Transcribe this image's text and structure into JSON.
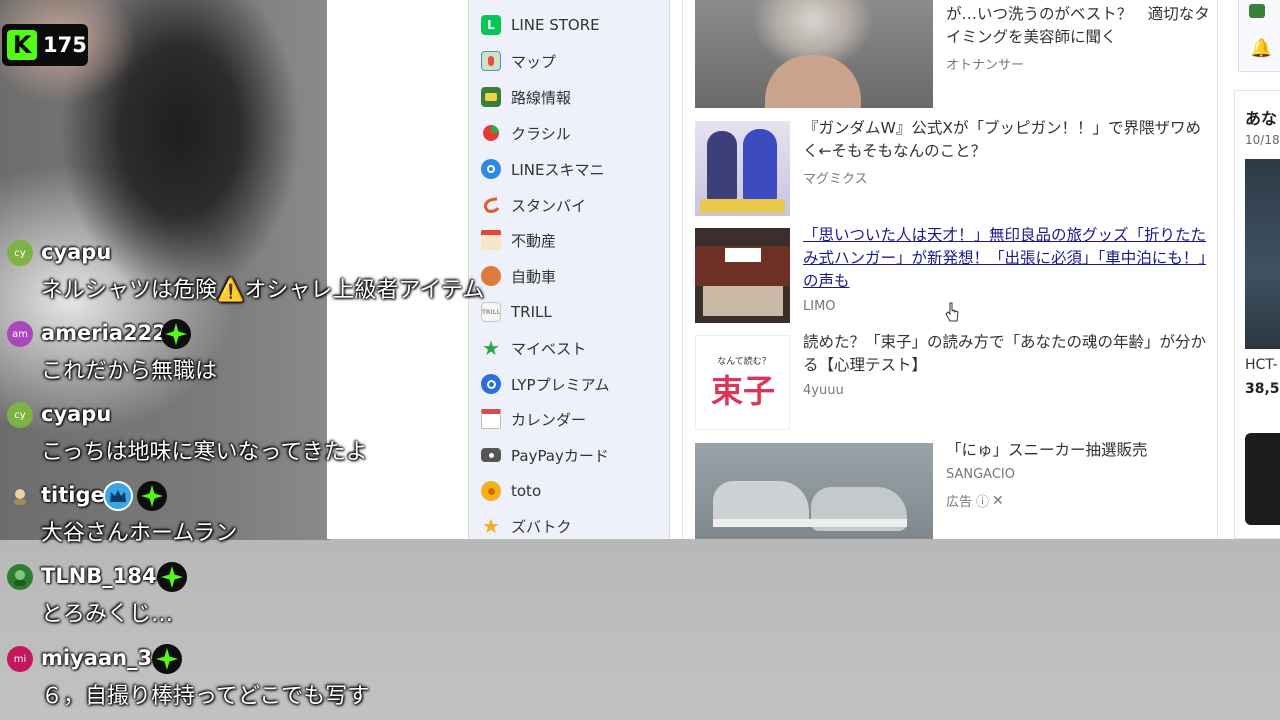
{
  "viewer_badge": {
    "count": "175",
    "brand_letter": "K",
    "accent": "#53fc18"
  },
  "menu": {
    "items": [
      {
        "label": "LINE STORE",
        "icon": "line-store-icon",
        "color": "#06c755"
      },
      {
        "label": "マップ",
        "icon": "map-icon",
        "color": "#4a8fd8"
      },
      {
        "label": "路線情報",
        "icon": "train-icon",
        "color": "#3b7d3b"
      },
      {
        "label": "クラシル",
        "icon": "kurashiru-icon",
        "color": "#e63a3a"
      },
      {
        "label": "LINEスキマニ",
        "icon": "sukimani-icon",
        "color": "#2b8ae6"
      },
      {
        "label": "スタンバイ",
        "icon": "standby-icon",
        "color": "#e85a2a"
      },
      {
        "label": "不動産",
        "icon": "house-icon",
        "color": "#e0463c"
      },
      {
        "label": "自動車",
        "icon": "car-icon",
        "color": "#e07a3c"
      },
      {
        "label": "TRILL",
        "icon": "trill-icon",
        "color": "#c8c8c8"
      },
      {
        "label": "マイベスト",
        "icon": "star-icon",
        "color": "#2ca84a"
      },
      {
        "label": "LYPプレミアム",
        "icon": "lyp-premium-icon",
        "color": "#2a6ee0"
      },
      {
        "label": "カレンダー",
        "icon": "calendar-icon",
        "color": "#d94a4a"
      },
      {
        "label": "PayPayカード",
        "icon": "paypay-card-icon",
        "color": "#555555"
      },
      {
        "label": "toto",
        "icon": "toto-icon",
        "color": "#f2b11a"
      },
      {
        "label": "ズバトク",
        "icon": "zubatoku-icon",
        "color": "#f2b11a"
      }
    ]
  },
  "news": [
    {
      "headline": "が…いつ洗うのがベスト？　適切なタイミングを美容師に聞く",
      "source": "オトナンサー"
    },
    {
      "headline": "『ガンダムW』公式Xが「ブッピガン！！」で界隈ザワめく←そもそもなんのこと？",
      "source": "マグミクス"
    },
    {
      "headline": "「思いついた人は天才！」無印良品の旅グッズ「折りたたみ式ハンガー」が新発想！「出張に必須」「車中泊にも！」の声も",
      "source": "LIMO"
    },
    {
      "headline": "読めた？「束子」の読み方で「あなたの魂の年齢」が分かる【心理テスト】",
      "source": "4yuuu",
      "thumb_question": "なんて読む？",
      "thumb_word": "束子"
    },
    {
      "headline": "「にゅ」スニーカー抽選販売",
      "source": "SANGACIO",
      "ad_label": "広告"
    }
  ],
  "right_panel": {
    "heading": "あな",
    "date": "10/18",
    "product": "HCT-",
    "price": "38,5"
  },
  "chat": [
    {
      "initials": "cy",
      "user": "cyapu",
      "avatar_color": "#7cb342",
      "message": "ネルシャツは危険⚠️オシャレ上級者アイテム",
      "badges": []
    },
    {
      "initials": "am",
      "user": "ameria222",
      "avatar_color": "#ab47bc",
      "message": "これだから無職は",
      "badges": [
        "star"
      ]
    },
    {
      "initials": "cy",
      "user": "cyapu",
      "avatar_color": "#7cb342",
      "message": "こっちは地味に寒いなってきたよ",
      "badges": []
    },
    {
      "initials": "",
      "user": "titige",
      "avatar_color": "#6d6d6d",
      "message": "大谷さんホームラン",
      "badges": [
        "crown",
        "star"
      ]
    },
    {
      "initials": "",
      "user": "TLNB_184",
      "avatar_color": "#4caf50",
      "message": "とろみくじ…",
      "badges": [
        "star"
      ]
    },
    {
      "initials": "mi",
      "user": "miyaan_3",
      "avatar_color": "#c2185b",
      "message": "６，自撮り棒持ってどこでも写す",
      "badges": [
        "star"
      ]
    }
  ]
}
